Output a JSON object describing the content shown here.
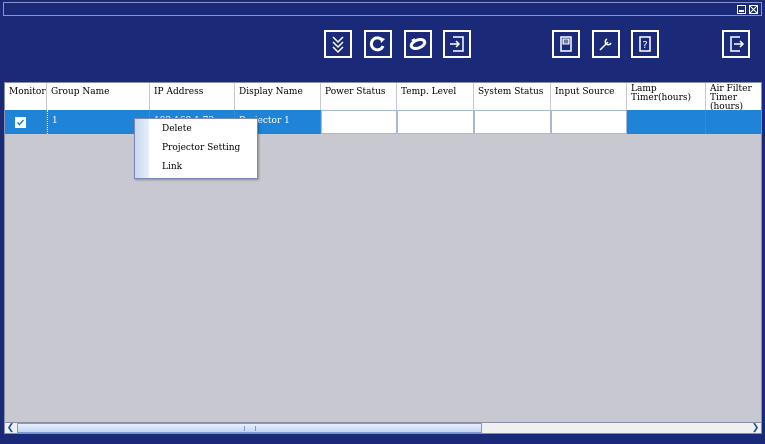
{
  "window": {
    "minimize_icon": "minimize-icon",
    "close_icon": "close-icon"
  },
  "toolbar": {
    "buttons": [
      {
        "name": "collapse-button",
        "icon": "chevron-double-down-icon"
      },
      {
        "name": "refresh-button",
        "icon": "refresh-icon"
      },
      {
        "name": "sync-button",
        "icon": "sync-icon"
      },
      {
        "name": "import-button",
        "icon": "import-icon"
      },
      {
        "name": "save-button",
        "icon": "save-icon"
      },
      {
        "name": "settings-button",
        "icon": "wrench-icon"
      },
      {
        "name": "help-button",
        "icon": "help-icon"
      },
      {
        "name": "exit-button",
        "icon": "exit-icon"
      }
    ]
  },
  "table": {
    "columns": [
      "Monitor",
      "Group Name",
      "IP Address",
      "Display Name",
      "Power Status",
      "Temp. Level",
      "System Status",
      "Input Source",
      "Lamp Timer(hours)",
      "Air Filter Timer (hours)"
    ],
    "row": {
      "monitor_checked": true,
      "group_name": "1",
      "ip_address": "192.168.1.73",
      "display_name": "Projector 1",
      "power_status": "",
      "temp_level": "",
      "system_status": "",
      "input_source": "",
      "lamp_timer": "",
      "air_filter_timer": ""
    }
  },
  "context_menu": {
    "items": [
      "Delete",
      "Projector Setting",
      "Link"
    ]
  },
  "colors": {
    "window_bg": "#1a2a78",
    "selected_row": "#1f84d8",
    "table_bg": "#c8c8d0"
  }
}
